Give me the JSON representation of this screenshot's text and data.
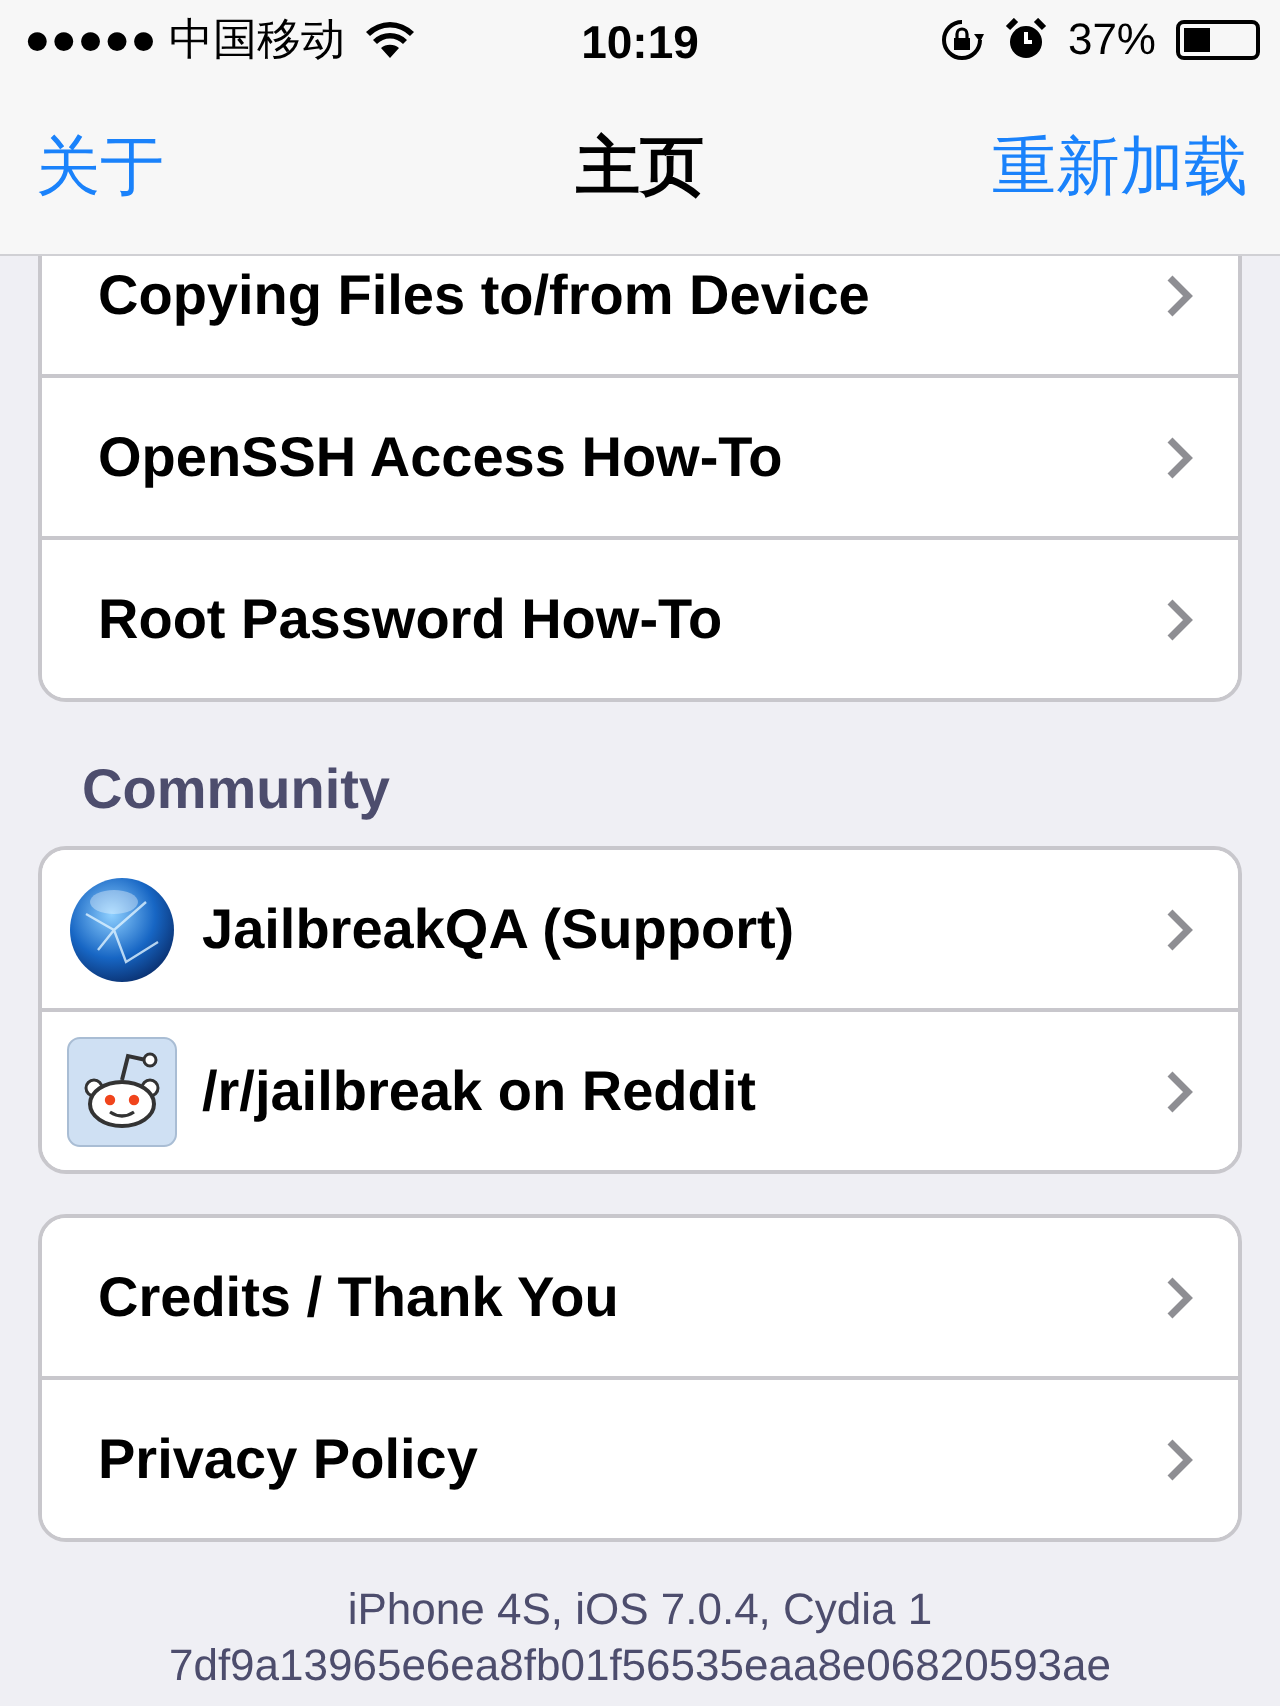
{
  "status_bar": {
    "carrier": "●●●●● 中国移动",
    "time": "10:19",
    "battery": "37%"
  },
  "nav_bar": {
    "left": "关于",
    "title": "主页",
    "right": "重新加载"
  },
  "groups": [
    {
      "rows": [
        {
          "kind": "plain",
          "label": "Copying Files to/from Device"
        },
        {
          "kind": "plain",
          "label": "OpenSSH Access How-To"
        },
        {
          "kind": "plain",
          "label": "Root Password How-To"
        }
      ]
    },
    {
      "header": "Community",
      "rows": [
        {
          "kind": "globe",
          "label": "JailbreakQA (Support)"
        },
        {
          "kind": "mascot",
          "label": "/r/jailbreak on Reddit"
        }
      ]
    },
    {
      "rows": [
        {
          "kind": "plain",
          "label": "Credits / Thank You"
        },
        {
          "kind": "plain",
          "label": "Privacy Policy"
        }
      ]
    }
  ],
  "footer": [
    "iPhone 4S, iOS 7.0.4, Cydia 1",
    "7df9a13965e6ea8fb01f56535eaa8e06820593ae"
  ]
}
